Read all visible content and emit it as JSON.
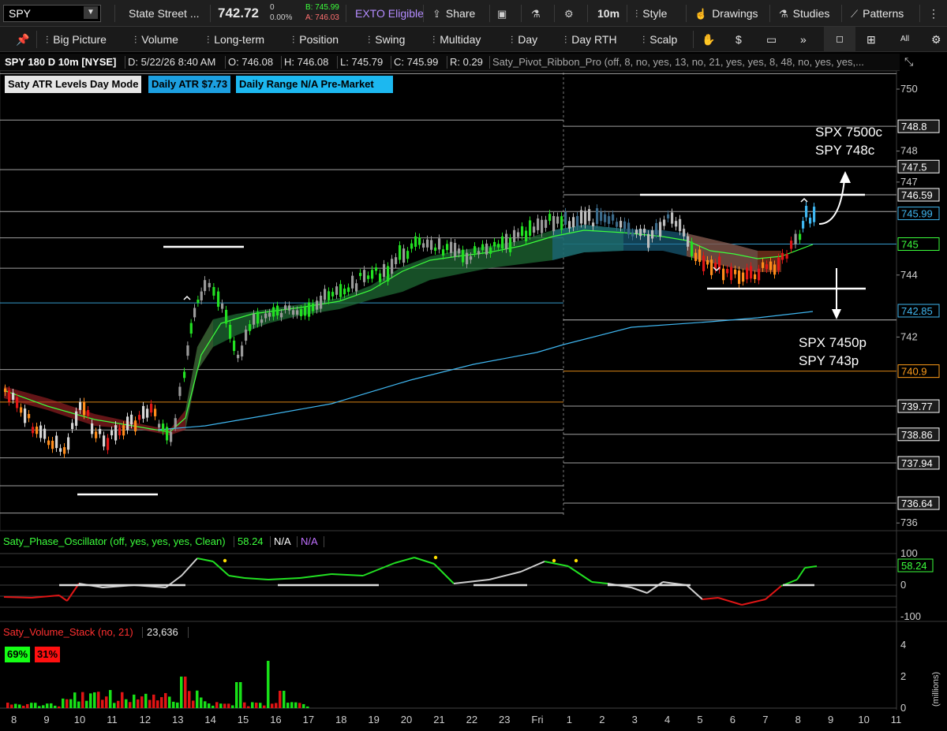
{
  "toolbar": {
    "symbol": "SPY",
    "company": "State Street ...",
    "last": "742.72",
    "change": "0",
    "change_pct": "0.00%",
    "bid": "B: 745.99",
    "ask": "A: 746.03",
    "exto": "EXTO Eligible",
    "share": "Share",
    "interval": "10m",
    "style": "Style",
    "drawings": "Drawings",
    "studies": "Studies",
    "patterns": "Patterns"
  },
  "presets": {
    "big_picture": "Big Picture",
    "volume": "Volume",
    "long_term": "Long-term",
    "position": "Position",
    "swing": "Swing",
    "multiday": "Multiday",
    "day": "Day",
    "day_rth": "Day RTH",
    "scalp": "Scalp",
    "all": "All"
  },
  "infobar": {
    "title": "SPY 180 D 10m [NYSE]",
    "date": "D: 5/22/26 8:40 AM",
    "open": "O: 746.08",
    "high": "H: 746.08",
    "low": "L: 745.79",
    "close": "C: 745.99",
    "range": "R: 0.29",
    "study": "Saty_Pivot_Ribbon_Pro (off, 8, no, yes, 13, no, 21, yes, yes, 8, 48, no, yes, yes,..."
  },
  "badges": {
    "atr_mode": "Saty ATR Levels Day Mode",
    "daily_atr": "Daily ATR $7.73",
    "daily_range": "Daily Range N/A Pre-Market"
  },
  "annotations": {
    "call_1": "SPX 7500c",
    "call_2": "SPY 748c",
    "put_1": "SPX 7450p",
    "put_2": "SPY 743p"
  },
  "price_axis": {
    "ticks": [
      "750",
      "748",
      "747",
      "744",
      "742",
      "736"
    ],
    "labels": [
      {
        "text": "748.8",
        "color": "#ffffff"
      },
      {
        "text": "747.5",
        "color": "#ffffff"
      },
      {
        "text": "746.59",
        "color": "#ffffff"
      },
      {
        "text": "745.99",
        "color": "#3fb6f0"
      },
      {
        "text": "745",
        "color": "#3cff3c"
      },
      {
        "text": "742.85",
        "color": "#3fb6f0"
      },
      {
        "text": "740.9",
        "color": "#ff9c1a"
      },
      {
        "text": "739.77",
        "color": "#ffffff"
      },
      {
        "text": "738.86",
        "color": "#ffffff"
      },
      {
        "text": "737.94",
        "color": "#ffffff"
      },
      {
        "text": "736.64",
        "color": "#ffffff"
      }
    ]
  },
  "oscillator": {
    "title": "Saty_Phase_Oscillator (off, yes, yes, yes, Clean)",
    "value": "58.24",
    "na1": "N/A",
    "na2": "N/A",
    "ticks": [
      "100",
      "0",
      "-100"
    ],
    "value_label": "58.24"
  },
  "volume": {
    "title": "Saty_Volume_Stack (no, 21)",
    "value": "23,636",
    "buy_pct": "69%",
    "sell_pct": "31%",
    "ticks": [
      "4",
      "2",
      "0"
    ],
    "unit": "(millions)"
  },
  "time_axis": [
    "8",
    "9",
    "10",
    "11",
    "12",
    "13",
    "14",
    "15",
    "16",
    "17",
    "18",
    "19",
    "20",
    "21",
    "22",
    "23",
    "Fri",
    "1",
    "2",
    "3",
    "4",
    "5",
    "6",
    "7",
    "8",
    "9",
    "10",
    "11"
  ],
  "chart_data": {
    "type": "candlestick",
    "interval": "10m",
    "ylim": [
      736,
      750
    ],
    "support_levels": [
      748.8,
      747.5,
      746.59,
      745,
      742.85,
      740.9,
      739.77,
      738.86,
      737.94,
      736.64
    ],
    "last_close": 745.99,
    "daily_atr": 7.73
  },
  "colors": {
    "bull": "#26e026",
    "bear": "#e01616",
    "neutral": "#bdbdbd",
    "ema_blue": "#3fb6f0",
    "accent_cyan": "#00bfff",
    "orange": "#ff9c1a"
  }
}
